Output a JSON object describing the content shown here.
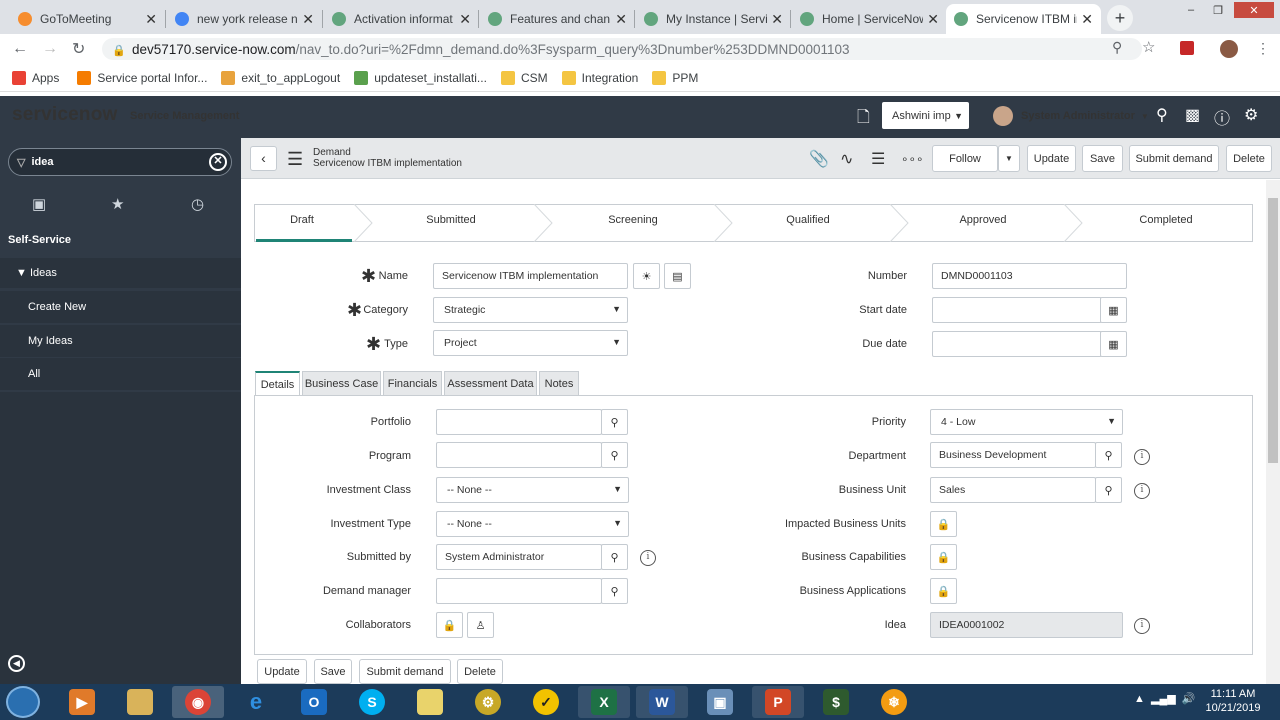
{
  "browser": {
    "tabs": [
      {
        "title": "GoToMeeting",
        "icon_color": "#f68d2e",
        "active": false
      },
      {
        "title": "new york release n",
        "icon_color": "#4285f4",
        "active": false
      },
      {
        "title": "Activation informat",
        "icon_color": "#62a57e",
        "active": false
      },
      {
        "title": "Features and chan",
        "icon_color": "#62a57e",
        "active": false
      },
      {
        "title": "My Instance | Servi",
        "icon_color": "#62a57e",
        "active": false
      },
      {
        "title": "Home | ServiceNow",
        "icon_color": "#62a57e",
        "active": false
      },
      {
        "title": "Servicenow ITBM im",
        "icon_color": "#62a57e",
        "active": true
      }
    ],
    "url_host": "dev57170.service-now.com",
    "url_path": "/nav_to.do?uri=%2Fdmn_demand.do%3Fsysparm_query%3Dnumber%253DDMND0001103",
    "bookmarks": [
      {
        "label": "Apps",
        "icon": "apps-grid-icon",
        "color": "#e94235"
      },
      {
        "label": "Service portal Infor...",
        "icon": "blogger-icon",
        "color": "#f57c00"
      },
      {
        "label": "exit_to_appLogout",
        "icon": "s-icon",
        "color": "#e8a33d"
      },
      {
        "label": "updateset_installati...",
        "icon": "feather-icon",
        "color": "#5aa04d"
      },
      {
        "label": "CSM",
        "icon": "folder-icon",
        "color": "#f4c542"
      },
      {
        "label": "Integration",
        "icon": "folder-icon",
        "color": "#f4c542"
      },
      {
        "label": "PPM",
        "icon": "folder-icon",
        "color": "#f4c542"
      }
    ]
  },
  "header": {
    "logo": "servicenow",
    "product": "Service Management",
    "domain": "Ashwini imp",
    "user": "System Administrator"
  },
  "sidebar": {
    "filter_value": "idea",
    "section": "Self-Service",
    "module": "Ideas",
    "items": [
      "Create New",
      "My Ideas",
      "All"
    ]
  },
  "form": {
    "record_type": "Demand",
    "record_name": "Servicenow ITBM implementation",
    "buttons": {
      "follow": "Follow",
      "update": "Update",
      "save": "Save",
      "submit": "Submit demand",
      "delete": "Delete"
    },
    "stages": [
      "Draft",
      "Submitted",
      "Screening",
      "Qualified",
      "Approved",
      "Completed"
    ],
    "active_stage": "Draft",
    "top_fields": {
      "name_label": "Name",
      "name_value": "Servicenow ITBM implementation",
      "category_label": "Category",
      "category_value": "Strategic",
      "type_label": "Type",
      "type_value": "Project",
      "number_label": "Number",
      "number_value": "DMND0001103",
      "start_label": "Start date",
      "start_value": "",
      "due_label": "Due date",
      "due_value": ""
    },
    "tabs": [
      "Details",
      "Business Case",
      "Financials",
      "Assessment Data",
      "Notes"
    ],
    "details_left": {
      "portfolio_label": "Portfolio",
      "portfolio_value": "",
      "program_label": "Program",
      "program_value": "",
      "inv_class_label": "Investment Class",
      "inv_class_value": "-- None --",
      "inv_type_label": "Investment Type",
      "inv_type_value": "-- None --",
      "submitted_label": "Submitted by",
      "submitted_value": "System Administrator",
      "manager_label": "Demand manager",
      "manager_value": "",
      "collab_label": "Collaborators"
    },
    "details_right": {
      "priority_label": "Priority",
      "priority_value": "4 - Low",
      "dept_label": "Department",
      "dept_value": "Business Development",
      "bu_label": "Business Unit",
      "bu_value": "Sales",
      "ibu_label": "Impacted Business Units",
      "caps_label": "Business Capabilities",
      "apps_label": "Business Applications",
      "idea_label": "Idea",
      "idea_value": "IDEA0001002"
    }
  },
  "taskbar": {
    "time": "11:11 AM",
    "date": "10/21/2019"
  }
}
